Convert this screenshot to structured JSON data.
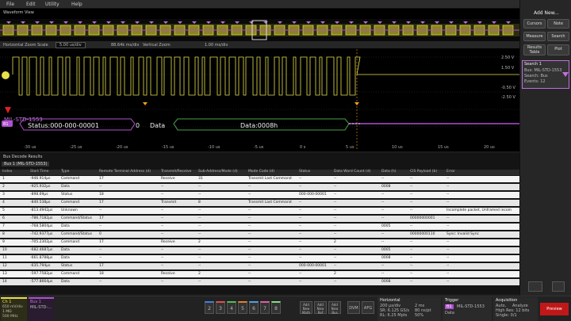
{
  "menu": {
    "file": "File",
    "edit": "Edit",
    "utility": "Utility",
    "help": "Help"
  },
  "waveform_view": {
    "title": "Waveform View",
    "zoom_scale_label": "Horizontal Zoom Scale",
    "zoom_scale_value": "5.00 us/div",
    "zoom_pos": "88.64k ms/div",
    "vert_label": "Vertical Zoom",
    "vert_value": "1.00 ms/div",
    "y_labels": [
      "2.50 V",
      "1.50 V",
      "-0.50 V",
      "-2.50 V"
    ],
    "x_ticks": [
      "-30 us",
      "-25 us",
      "-20 us",
      "-15 us",
      "-10 us",
      "-5 us",
      "0 s",
      "5 us",
      "10 us",
      "15 us",
      "20 us"
    ]
  },
  "bus": {
    "name": "MIL-STD-1553",
    "badge": "B1",
    "status": "Status:000-000-00001",
    "parity": "0",
    "data_label": "Data",
    "data_value": "Data:0008h"
  },
  "right_panel": {
    "add_new": "Add New...",
    "buttons": [
      "Cursors",
      "Note",
      "Measure",
      "Search",
      "Results Table",
      "Plot"
    ],
    "search": {
      "title": "Search 1",
      "bus": "Bus: MIL-STD-1553",
      "search_for": "Search: Bus",
      "events": "Events: 12"
    }
  },
  "results": {
    "title": "Bus Decode Results",
    "tab": "Bus 1 (MIL-STD-1553)",
    "headers": [
      "Index",
      "Start Time",
      "Type",
      "Remote Terminal Address (d)",
      "Transmit/Receive",
      "Sub-Address/Mode (d)",
      "Mode Code (d)",
      "Status",
      "Data Word Count (d)",
      "Data (h)",
      "CIS Payload (b)",
      "Error"
    ],
    "rows": [
      [
        "1",
        "-946.914µs",
        "Command",
        "17",
        "Receive",
        "31",
        "Transmit Last Command",
        "--",
        "--",
        "--",
        "--",
        "--"
      ],
      [
        "2",
        "-925.932µs",
        "Data",
        "--",
        "--",
        "--",
        "--",
        "--",
        "--",
        "0008",
        "--",
        "--"
      ],
      [
        "3",
        "-898.69µs",
        "Status",
        "18",
        "--",
        "--",
        "--",
        "000-000-00001",
        "--",
        "--",
        "--",
        "--"
      ],
      [
        "4",
        "-840.538µs",
        "Command",
        "17",
        "Transmit",
        "8",
        "Transmit Last Command",
        "--",
        "--",
        "--",
        "--",
        "--"
      ],
      [
        "5",
        "-813.4942µs",
        "Unknown",
        "--",
        "--",
        "--",
        "--",
        "--",
        "--",
        "--",
        "--",
        "Incomplete packet, Unframed incom"
      ],
      [
        "6",
        "-786.7182µs",
        "Command/Status",
        "17",
        "--",
        "--",
        "--",
        "--",
        "--",
        "--",
        "00000000001",
        "--"
      ],
      [
        "7",
        "-768.5804µs",
        "Data",
        "--",
        "--",
        "--",
        "--",
        "--",
        "--",
        "0005",
        "--",
        "--"
      ],
      [
        "8",
        "-742.9377µs",
        "Command/Status",
        "0",
        "--",
        "--",
        "--",
        "--",
        "--",
        "--",
        "00000000110",
        "Sync: Invalid Sync"
      ],
      [
        "9",
        "-705.2302µs",
        "Command",
        "17",
        "Receive",
        "2",
        "--",
        "--",
        "2",
        "--",
        "--",
        "--"
      ],
      [
        "10",
        "-682.4687µs",
        "Data",
        "--",
        "--",
        "--",
        "--",
        "--",
        "--",
        "0005",
        "--",
        "--"
      ],
      [
        "11",
        "-661.8788µs",
        "Data",
        "--",
        "--",
        "--",
        "--",
        "--",
        "--",
        "0008",
        "--",
        "--"
      ],
      [
        "12",
        "-635.794µs",
        "Status",
        "17",
        "--",
        "--",
        "--",
        "000-000-00001",
        "--",
        "--",
        "--",
        "--"
      ],
      [
        "13",
        "-597.7582µs",
        "Command",
        "18",
        "Receive",
        "2",
        "--",
        "--",
        "2",
        "--",
        "--",
        "--"
      ],
      [
        "14",
        "-577.8664µs",
        "Data",
        "--",
        "--",
        "--",
        "--",
        "--",
        "--",
        "0008",
        "--",
        "--"
      ]
    ]
  },
  "bottom": {
    "ch1": "Ch 1",
    "ch1_v": "650 mV/div",
    "ch1_bw": "1 MΩ",
    "ch1_bw2": "500 MHz",
    "bus1": "Bus 1",
    "bus1_sub": "MIL-STD-...",
    "channels": [
      "2",
      "3",
      "4",
      "5",
      "6",
      "7",
      "8"
    ],
    "add_math": "Add New Math",
    "add_ref": "Add New Ref",
    "add_bus": "Add New Bus",
    "dvm": "DVM",
    "afg": "AFG",
    "horizontal": {
      "title": "Horizontal",
      "scale": "200 µs/div",
      "sr": "SR: 6.125 GS/s",
      "rl": "RL: 6.25 Mpts",
      "pos": "2 ms",
      "pos2": "80 ns/pt",
      "pct": "50%"
    },
    "trigger": {
      "title": "Trigger",
      "badge": "B1",
      "std": "MIL-STD-1553",
      "type": "Data"
    },
    "acquisition": {
      "title": "Acquisition",
      "mode": "Auto,",
      "analyze": "Analyze",
      "res": "High Res: 12 bits",
      "single": "Single: 0/1"
    },
    "preview": "Preview"
  },
  "colors": {
    "ch1": "#e8e04a",
    "bus": "#b04fd0",
    "accent": "#f0a020"
  }
}
